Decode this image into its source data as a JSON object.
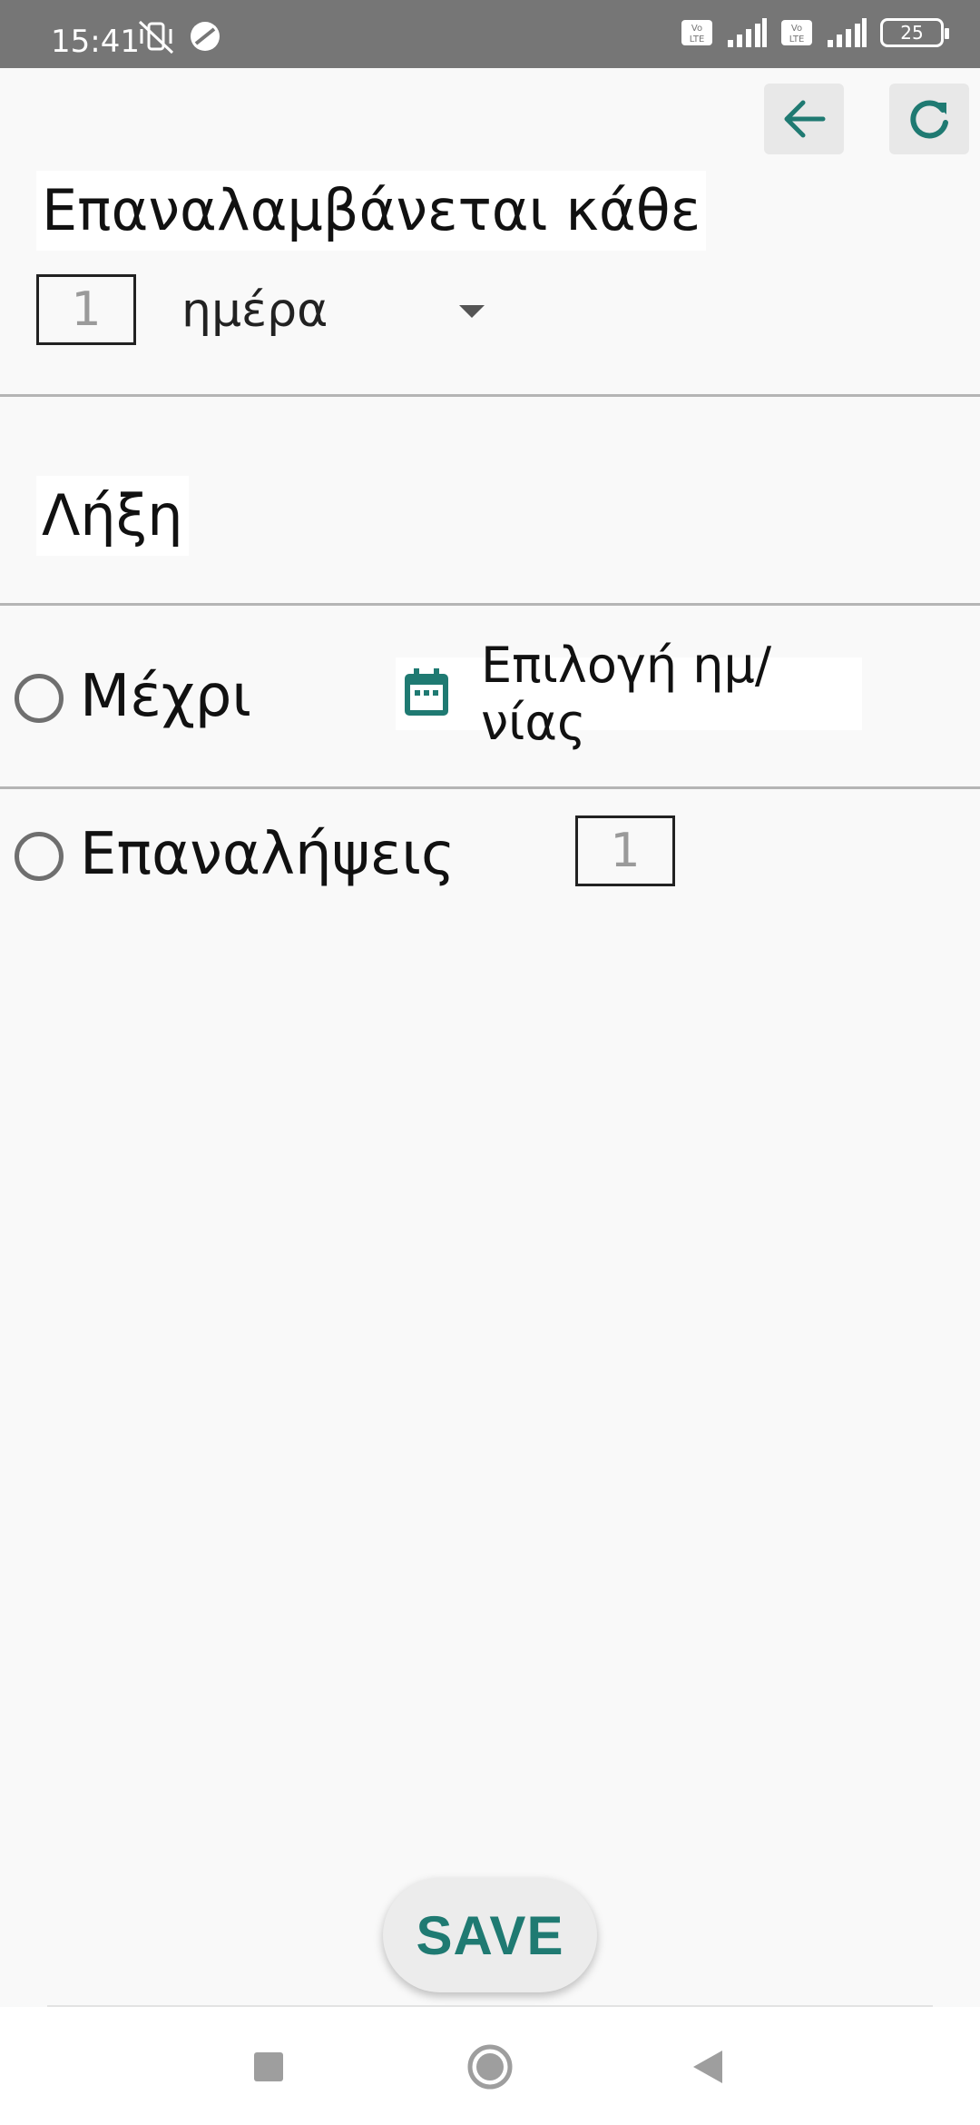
{
  "status_bar": {
    "time": "15:41",
    "battery": "25",
    "icons": [
      "vibrate-off-icon",
      "sync-icon",
      "volte-icon",
      "signal-icon",
      "volte-icon",
      "signal-icon",
      "battery-icon"
    ]
  },
  "toolbar": {
    "back_icon": "arrow-left-icon",
    "refresh_icon": "refresh-icon"
  },
  "repeat": {
    "title": "Επαναλαμβάνεται κάθε",
    "interval_placeholder": "1",
    "unit_selected": "ημέρα"
  },
  "end": {
    "title": "Λήξη",
    "until_label": "Μέχρι",
    "date_placeholder": "Επιλογή ημ/νίας",
    "repetitions_label": "Επαναλήψεις",
    "repetitions_placeholder": "1"
  },
  "actions": {
    "save_label": "SAVE"
  },
  "colors": {
    "accent": "#1f7a72",
    "status_bar": "#767676",
    "background": "#f9f9f9"
  }
}
